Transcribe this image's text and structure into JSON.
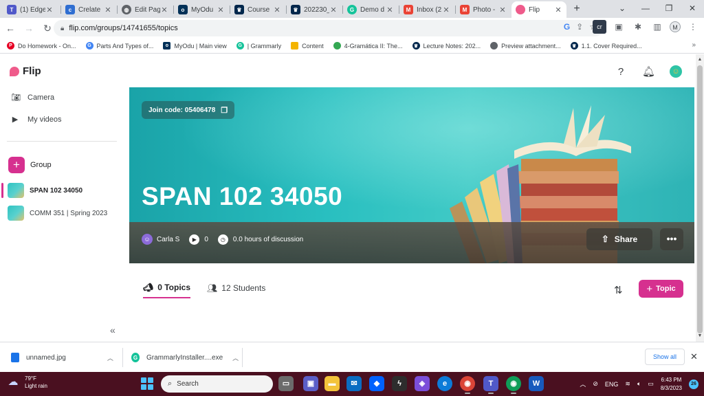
{
  "browser": {
    "tabs": [
      {
        "title": "(1) Edge",
        "icon": "teams-icon",
        "color": "#5059c9"
      },
      {
        "title": "Crelate",
        "icon": "crelate-icon",
        "color": "#2f6ed1"
      },
      {
        "title": "Edit Pag",
        "icon": "globe-icon",
        "color": "#5f6368"
      },
      {
        "title": "MyOdu",
        "icon": "odu-icon",
        "color": "#003057"
      },
      {
        "title": "Course",
        "icon": "crown-icon",
        "color": "#00274c"
      },
      {
        "title": "202230_",
        "icon": "crown-icon",
        "color": "#00274c"
      },
      {
        "title": "Demo d",
        "icon": "grammarly-icon",
        "color": "#15c39a"
      },
      {
        "title": "Inbox (2",
        "icon": "gmail-icon",
        "color": "#ea4335"
      },
      {
        "title": "Photo -",
        "icon": "gmail-icon",
        "color": "#ea4335"
      },
      {
        "title": "Flip",
        "icon": "flip-icon",
        "color": "#ef5b8b"
      }
    ],
    "url": "flip.com/groups/14741655/topics",
    "profile_initial": "M",
    "bookmarks": [
      {
        "label": "Do Homework - On...",
        "icon": "pinterest-icon",
        "color": "#e60023"
      },
      {
        "label": "Parts And Types of...",
        "icon": "google-icon",
        "color": "#4285f4"
      },
      {
        "label": "MyOdu | Main view",
        "icon": "odu-icon",
        "color": "#003057"
      },
      {
        "label": "| Grammarly",
        "icon": "grammarly-icon",
        "color": "#15c39a"
      },
      {
        "label": "Content",
        "icon": "content-icon",
        "color": "#f4b400"
      },
      {
        "label": "4-Gramática II: The...",
        "icon": "bookmark-icon",
        "color": "#34a853"
      },
      {
        "label": "Lecture Notes: 202...",
        "icon": "crown-icon",
        "color": "#00274c"
      },
      {
        "label": "Preview attachment...",
        "icon": "globe-icon",
        "color": "#5f6368"
      },
      {
        "label": "1.1. Cover Required...",
        "icon": "crown-icon",
        "color": "#00274c"
      }
    ]
  },
  "app": {
    "name": "Flip",
    "brand_color": "#d6308f",
    "sidebar": {
      "camera": "Camera",
      "my_videos": "My videos",
      "group_button": "Group",
      "groups": [
        {
          "name": "SPAN 102 34050",
          "active": true
        },
        {
          "name": "COMM 351 | Spring 2023",
          "active": false
        }
      ]
    },
    "banner": {
      "join_code": "Join code: 05406478",
      "group_title": "SPAN 102 34050",
      "owner": "Carla S",
      "video_count": "0",
      "discussion": "0.0 hours of discussion",
      "share_label": "Share"
    },
    "tabs": {
      "topics": "0 Topics",
      "students": "12 Students"
    },
    "topic_button": "Topic"
  },
  "downloads": {
    "items": [
      {
        "name": "unnamed.jpg",
        "icon": "file-icon",
        "color": "#1a73e8"
      },
      {
        "name": "GrammarlyInstaller....exe",
        "icon": "grammarly-icon",
        "color": "#15c39a"
      }
    ],
    "show_all": "Show all"
  },
  "taskbar": {
    "weather_temp": "79°F",
    "weather_desc": "Light rain",
    "weather_badge": "1",
    "search_placeholder": "Search",
    "language": "ENG",
    "time": "6:43 PM",
    "date": "8/3/2023",
    "notifications": "26"
  }
}
